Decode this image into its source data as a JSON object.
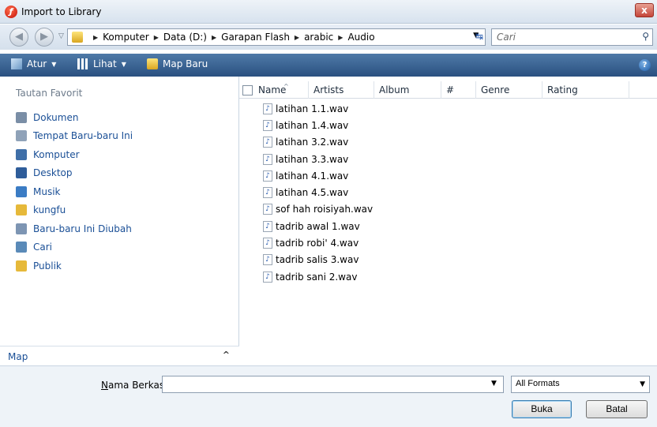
{
  "window": {
    "title": "Import to Library",
    "close_label": "x"
  },
  "address": {
    "crumbs": [
      "Komputer",
      "Data (D:)",
      "Garapan Flash",
      "arabic",
      "Audio"
    ],
    "search_placeholder": "Cari"
  },
  "toolbar": {
    "organize_label": "Atur",
    "view_label": "Lihat",
    "new_folder_label": "Map Baru"
  },
  "sidebar": {
    "heading": "Tautan Favorit",
    "items": [
      {
        "label": "Dokumen",
        "icon": "documents-icon",
        "color": "#7a8ea6"
      },
      {
        "label": "Tempat Baru-baru Ini",
        "icon": "recent-places-icon",
        "color": "#8fa2b8"
      },
      {
        "label": "Komputer",
        "icon": "computer-icon",
        "color": "#3f6fa8"
      },
      {
        "label": "Desktop",
        "icon": "desktop-icon",
        "color": "#2f5d9a"
      },
      {
        "label": "Musik",
        "icon": "music-icon",
        "color": "#3b7cc4"
      },
      {
        "label": "kungfu",
        "icon": "folder-icon",
        "color": "#e6b93a"
      },
      {
        "label": "Baru-baru Ini Diubah",
        "icon": "recently-changed-icon",
        "color": "#7d95b3"
      },
      {
        "label": "Cari",
        "icon": "search-folder-icon",
        "color": "#5a8ab8"
      },
      {
        "label": "Publik",
        "icon": "public-folder-icon",
        "color": "#e6b93a"
      }
    ],
    "footer_label": "Map"
  },
  "columns": [
    "Name",
    "Artists",
    "Album",
    "#",
    "Genre",
    "Rating"
  ],
  "files": [
    "latihan 1.1.wav",
    "latihan 1.4.wav",
    "latihan 3.2.wav",
    "latihan 3.3.wav",
    "latihan 4.1.wav",
    "latihan 4.5.wav",
    "sof hah roisiyah.wav",
    "tadrib awal 1.wav",
    "tadrib robi' 4.wav",
    "tadrib salis 3.wav",
    "tadrib sani 2.wav"
  ],
  "bottom": {
    "filename_label_key": "N",
    "filename_label_rest": "ama Berkas:",
    "filename_value": "",
    "filter_value": "All Formats",
    "open_label": "Buka",
    "cancel_label": "Batal"
  }
}
